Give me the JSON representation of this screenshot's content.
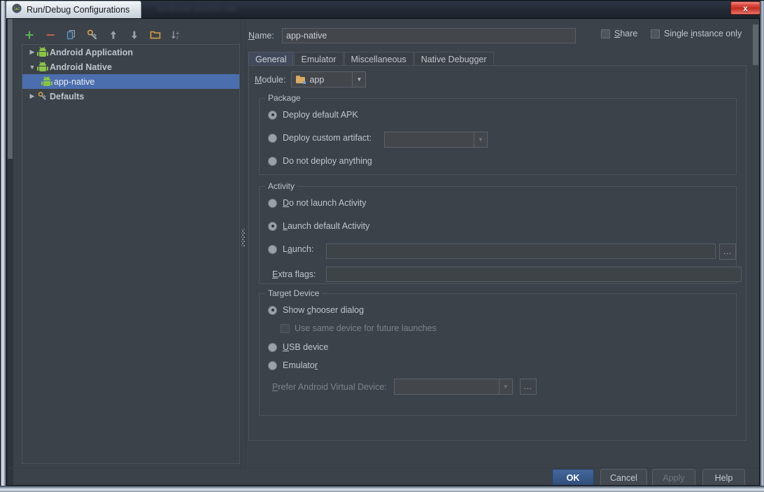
{
  "window": {
    "title": "Run/Debug Configurations",
    "title_icon": "android-studio-icon",
    "close_label": "x",
    "background_blur_text": "android-studio-ide"
  },
  "toolbar": {
    "items": [
      {
        "name": "add-configuration",
        "glyph": "+"
      },
      {
        "name": "remove-configuration",
        "glyph": "−"
      },
      {
        "name": "copy-configuration",
        "glyph": "copy"
      },
      {
        "name": "edit-defaults",
        "glyph": "wrench"
      },
      {
        "name": "move-up",
        "glyph": "↑"
      },
      {
        "name": "move-down",
        "glyph": "↓"
      },
      {
        "name": "create-folder",
        "glyph": "folder"
      },
      {
        "name": "sort-alphabetically",
        "glyph": "sort-az"
      }
    ]
  },
  "tree": {
    "nodes": [
      {
        "label": "Android Application",
        "expanded": false,
        "icon": "android-icon",
        "selected": false,
        "child": false
      },
      {
        "label": "Android Native",
        "expanded": true,
        "icon": "android-icon",
        "selected": false,
        "child": false
      },
      {
        "label": "app-native",
        "expanded": null,
        "icon": "android-icon",
        "selected": true,
        "child": true
      },
      {
        "label": "Defaults",
        "expanded": false,
        "icon": "wrench-icon",
        "selected": false,
        "child": false
      }
    ]
  },
  "form": {
    "name_label": "Name:",
    "name_mnemonic": "N",
    "name_value": "app-native",
    "share_label": "Share",
    "share_mnemonic": "S",
    "share_checked": false,
    "single_instance_label": "Single instance only",
    "single_instance_pre": "Single ",
    "single_instance_mnemonic": "i",
    "single_instance_post": "nstance only",
    "single_instance_checked": false
  },
  "tabs": [
    {
      "label": "General",
      "active": true
    },
    {
      "label": "Emulator",
      "active": false
    },
    {
      "label": "Miscellaneous",
      "active": false
    },
    {
      "label": "Native Debugger",
      "active": false
    }
  ],
  "general": {
    "module_label": "Module:",
    "module_mnemonic": "M",
    "module_value": "app",
    "module_icon": "module-folder-icon",
    "package": {
      "title": "Package",
      "options": [
        {
          "label": "Deploy default APK",
          "selected": true
        },
        {
          "label": "Deploy custom artifact:",
          "selected": false
        },
        {
          "label": "Do not deploy anything",
          "selected": false
        }
      ],
      "artifact_value": "",
      "artifact_enabled": false
    },
    "activity": {
      "title": "Activity",
      "options": [
        {
          "label": "Do not launch Activity",
          "pre": "",
          "mnemonic": "D",
          "post": "o not launch Activity",
          "selected": false
        },
        {
          "label": "Launch default Activity",
          "pre": "",
          "mnemonic": "L",
          "post": "aunch default Activity",
          "selected": true
        },
        {
          "label": "Launch:",
          "pre": "L",
          "mnemonic": "a",
          "post": "unch:",
          "selected": false
        }
      ],
      "launch_value": "",
      "launch_browse": "...",
      "extra_flags_label": "Extra flags:",
      "extra_flags_pre": "",
      "extra_flags_mnemonic": "E",
      "extra_flags_post": "xtra flags:",
      "extra_flags_value": ""
    },
    "target_device": {
      "title": "Target Device",
      "options": [
        {
          "pre": "Show ",
          "mnemonic": "c",
          "post": "hooser dialog",
          "selected": true
        },
        {
          "pre": "",
          "mnemonic": "U",
          "post": "SB device",
          "selected": false
        },
        {
          "pre": "Emulato",
          "mnemonic": "r",
          "post": "",
          "selected": false
        }
      ],
      "use_same_device_label": "Use same device for future launches",
      "use_same_device_checked": false,
      "avd_label_pre": "",
      "avd_label_mnemonic": "P",
      "avd_label_post": "refer Android Virtual Device:",
      "avd_value": "",
      "avd_browse": "..."
    }
  },
  "footer": {
    "buttons": [
      {
        "label": "OK",
        "style": "primary"
      },
      {
        "label": "Cancel",
        "style": "normal"
      },
      {
        "label": "Apply",
        "style": "disabled"
      },
      {
        "label": "Help",
        "style": "normal"
      }
    ]
  },
  "colors": {
    "window_bg": "#3c4249",
    "selection": "#4b6eaf",
    "accent_green": "#8bc34a",
    "text": "#bfc5cc",
    "close_red": "#c42d21"
  }
}
